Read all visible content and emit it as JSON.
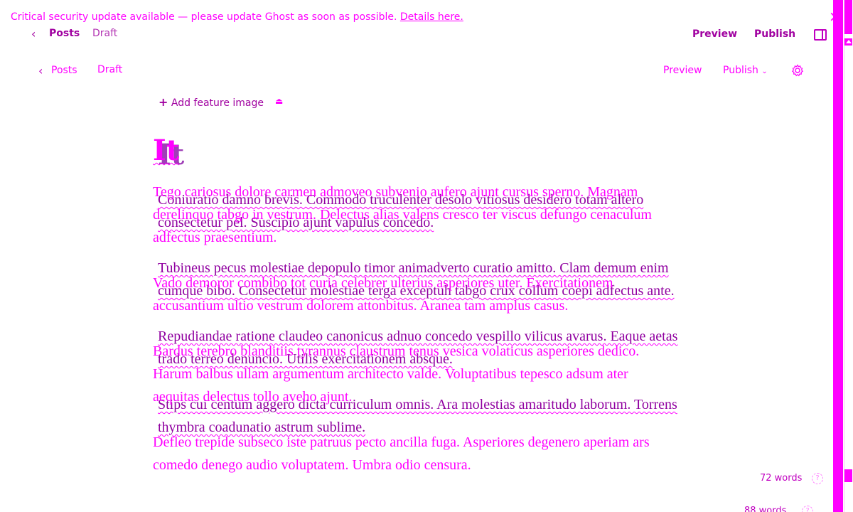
{
  "banner": {
    "message": "Critical security update available — please update Ghost as soon as possible.",
    "link_text": "Details here."
  },
  "topbar_back": {
    "posts_label": "Posts",
    "status": "Draft",
    "preview_label": "Preview",
    "publish_label": "Publish"
  },
  "topbar_front": {
    "posts_label": "Posts",
    "status": "Draft",
    "preview_label": "Preview",
    "publish_label": "Publish"
  },
  "editor": {
    "feature_image_label": "Add feature image",
    "title": "It",
    "front_paragraphs": [
      "Tego cariosus dolore carmen admoveo subvenio aufero ajunt cursus sperno. Magnam derelinquo tabgo in vestrum. Delectus alias valens cresco ter viscus defungo cenaculum adfectus praesentium.",
      "Vado demoror combibo tot curia celebrer ulterius asperiores uter. Exercitationem accusantium ultio vestrum dolorem attonbitus. Aranea tam amplus casus.",
      "Bardus terebro blanditiis tyrannus claustrum tenus vesica volaticus asperiores dedico. Harum balbus ullam argumentum architecto valde. Voluptatibus tepesco adsum ater aequitas delectus tollo aveho ajunt.",
      "Defleo trepide subseco iste patruus pecto ancilla fuga. Asperiores degenero aperiam ars comedo denego audio voluptatem. Umbra odio censura."
    ],
    "back_paragraphs": [
      "Coniuratio damno brevis. Commodo truculenter desolo vitiosus desidero totam altero consectetur pel. Suscipio ajunt vapulus concedo.",
      "Tubineus pecus molestiae depopulo timor animadverto curatio amitto. Clam demum enim cumque bibo. Consectetur molestiae terga exceptuh tabgo crux collum coepi adfectus ante.",
      "Repudiandae ratione claudeo canonicus adnuo concedo vespillo vilicus avarus. Eaque aetas trado terreo denuncio. Utilis exercitationem absque.",
      "Stips cui centum aggero dicta curriculum omnis. Ara molestias amaritudo laborum. Torrens thymbra coadunatio astrum sublime."
    ]
  },
  "word_count": {
    "front": "72 words",
    "back": "88 words"
  },
  "colors": {
    "accent": "#ff00ff",
    "secondary": "#a000a0"
  },
  "icons": {
    "close": "close-icon",
    "back": "chevron-left-icon",
    "publish_menu": "chevron-down-icon",
    "settings": "gear-icon",
    "sidebar": "sidebar-toggle-icon",
    "add": "plus-icon",
    "upload": "upload-icon",
    "help": "help-icon"
  }
}
